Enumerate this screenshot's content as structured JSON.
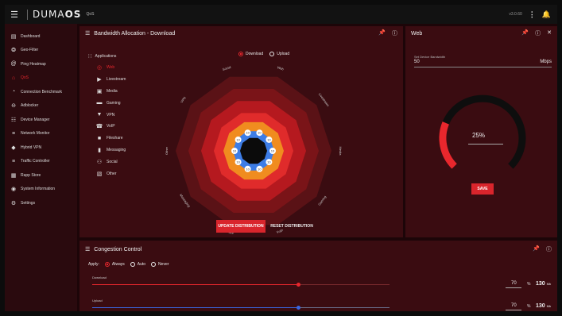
{
  "topbar": {
    "menu_icon": "hamburger-icon",
    "logo_light": "DUMA",
    "logo_bold": "OS",
    "crumb": "QoS",
    "version": "v3.0.60",
    "more_icon": "more-vert-icon",
    "bell_icon": "bell-icon"
  },
  "sidebar": {
    "items": [
      {
        "label": "Dashboard",
        "icon": "dashboard-icon"
      },
      {
        "label": "Geo-Filter",
        "icon": "geo-filter-icon"
      },
      {
        "label": "Ping Heatmap",
        "icon": "ping-heatmap-icon"
      },
      {
        "label": "QoS",
        "icon": "qos-icon",
        "active": true
      },
      {
        "label": "Connection Benchmark",
        "icon": "benchmark-icon"
      },
      {
        "label": "Adblocker",
        "icon": "adblocker-icon"
      },
      {
        "label": "Device Manager",
        "icon": "device-manager-icon"
      },
      {
        "label": "Network Monitor",
        "icon": "network-monitor-icon"
      },
      {
        "label": "Hybrid VPN",
        "icon": "hybrid-vpn-icon"
      },
      {
        "label": "Traffic Controller",
        "icon": "traffic-controller-icon"
      },
      {
        "label": "Rapp Store",
        "icon": "rapp-store-icon"
      },
      {
        "label": "System Information",
        "icon": "system-information-icon"
      },
      {
        "label": "Settings",
        "icon": "settings-icon"
      }
    ]
  },
  "bandwidth": {
    "title": "Bandwidth Allocation - Download",
    "applications_label": "Applications",
    "direction_options": [
      {
        "label": "Download",
        "selected": true
      },
      {
        "label": "Upload",
        "selected": false
      }
    ],
    "apps": [
      {
        "label": "Web",
        "icon": "web-icon",
        "active": true
      },
      {
        "label": "Livestream",
        "icon": "livestream-icon"
      },
      {
        "label": "Media",
        "icon": "media-icon"
      },
      {
        "label": "Gaming",
        "icon": "gaming-icon"
      },
      {
        "label": "VPN",
        "icon": "vpn-icon"
      },
      {
        "label": "VoIP",
        "icon": "voip-icon"
      },
      {
        "label": "Fileshare",
        "icon": "fileshare-icon"
      },
      {
        "label": "Messaging",
        "icon": "messaging-icon"
      },
      {
        "label": "Social",
        "icon": "social-icon"
      },
      {
        "label": "Other",
        "icon": "other-icon"
      }
    ],
    "radar_labels": [
      "Web",
      "Livestream",
      "Media",
      "Gaming",
      "VoIP",
      "Fileshare",
      "Messaging",
      "Other",
      "VPN",
      "Social"
    ],
    "handle_label": "10",
    "update_label": "UPDATE DISTRIBUTION",
    "reset_label": "RESET DISTRIBUTION"
  },
  "web": {
    "title": "Web",
    "field_label": "Set Device Bandwidth",
    "field_value": "50",
    "field_unit": "Mbps",
    "gauge_percent": 25,
    "gauge_text": "25%",
    "save_label": "SAVE"
  },
  "congestion": {
    "title": "Congestion Control",
    "apply_label": "Apply:",
    "apply_options": [
      {
        "label": "Always",
        "selected": true
      },
      {
        "label": "Auto",
        "selected": false
      },
      {
        "label": "Never",
        "selected": false
      }
    ],
    "download": {
      "label": "Download",
      "percent": "70",
      "value": "130",
      "unit": "Mb",
      "level": 0.695
    },
    "upload": {
      "label": "Upload",
      "percent": "70",
      "value": "130",
      "unit": "Mb",
      "level": 0.695
    },
    "percent_unit": "%"
  },
  "colors": {
    "accent": "#e8272d",
    "ring_colors": [
      "#5a1216",
      "#7a1418",
      "#b5191f",
      "#e02b2b",
      "#f08c1f",
      "#3d7de6"
    ],
    "upload_track": "#3a66e0"
  }
}
